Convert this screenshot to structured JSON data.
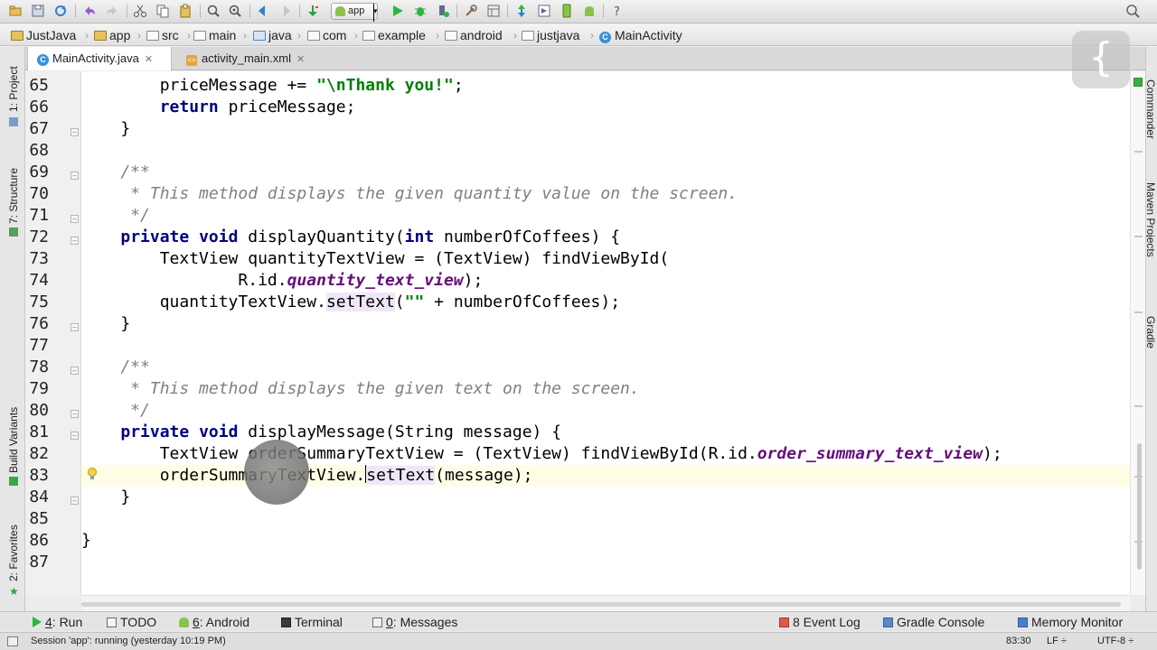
{
  "toolbar": {
    "run_config": "app",
    "icons": [
      "open-icon",
      "save-icon",
      "sync-icon",
      "undo-icon",
      "redo-icon",
      "cut-icon",
      "copy-icon",
      "paste-icon",
      "find-icon",
      "replace-icon",
      "back-icon",
      "forward-icon",
      "make-icon",
      "run-icon",
      "debug-icon",
      "attach-debugger-icon",
      "settings-icon",
      "project-structure-icon",
      "sdk-manager-icon",
      "avd-manager-icon",
      "android-device-monitor-icon",
      "gradle-sync-icon",
      "help-icon",
      "search-everywhere-icon"
    ]
  },
  "breadcrumb": [
    "JustJava",
    "app",
    "src",
    "main",
    "java",
    "com",
    "example",
    "android",
    "justjava",
    "MainActivity"
  ],
  "tabs": [
    {
      "label": "MainActivity.java",
      "active": true
    },
    {
      "label": "activity_main.xml",
      "active": false
    }
  ],
  "left_tools": {
    "project": "1: Project",
    "structure": "7: Structure",
    "build_variants": "Build Variants",
    "favorites": "2: Favorites"
  },
  "right_tools": {
    "commander": "Commander",
    "maven": "Maven Projects",
    "gradle": "Gradle"
  },
  "editor": {
    "line_numbers": [
      "65",
      "66",
      "67",
      "68",
      "69",
      "70",
      "71",
      "72",
      "73",
      "74",
      "75",
      "76",
      "77",
      "78",
      "79",
      "80",
      "81",
      "82",
      "83",
      "84",
      "85",
      "86",
      "87"
    ],
    "current_line": "83"
  },
  "code": {
    "l65": {
      "indent": "        ",
      "pre": "priceMessage += ",
      "str": "\"\\nThank you!\"",
      "post": ";"
    },
    "l66": {
      "indent": "        ",
      "kw": "return",
      "rest": " priceMessage;"
    },
    "l67": {
      "text": "    }"
    },
    "l69": {
      "text": "    /**"
    },
    "l70": {
      "text": "     * This method displays the given quantity value on the screen."
    },
    "l71": {
      "text": "     */"
    },
    "l72": {
      "indent": "    ",
      "kw1": "private",
      "kw2": "void",
      "name": " displayQuantity(",
      "kw3": "int",
      "rest": " numberOfCoffees) {"
    },
    "l73": {
      "text": "        TextView quantityTextView = (TextView) findViewById("
    },
    "l74": {
      "pre": "                R.id.",
      "field": "quantity_text_view",
      "post": ");"
    },
    "l75": {
      "pre": "        quantityTextView.",
      "method": "setText",
      "mid": "(",
      "str": "\"\"",
      "post": " + numberOfCoffees);"
    },
    "l76": {
      "text": "    }"
    },
    "l78": {
      "text": "    /**"
    },
    "l79": {
      "text": "     * This method displays the given text on the screen."
    },
    "l80": {
      "text": "     */"
    },
    "l81": {
      "indent": "    ",
      "kw1": "private",
      "kw2": "void",
      "rest": " displayMessage(String message) {"
    },
    "l82": {
      "pre": "        TextView orderSummaryTextView = (TextView) findViewById(R.id.",
      "field": "order_summary_text_view",
      "post": ");"
    },
    "l83": {
      "pre": "        orderSummaryTextView.",
      "method": "setText",
      "post": "(message);"
    },
    "l84": {
      "text": "    }"
    },
    "l86": {
      "text": "}"
    }
  },
  "tool_windows": {
    "run": {
      "key": "4",
      "label": ": Run"
    },
    "todo": "TODO",
    "android": {
      "key": "6",
      "label": ": Android"
    },
    "terminal": "Terminal",
    "messages": {
      "key": "0",
      "label": ": Messages"
    },
    "event_log": {
      "key": "8",
      "label": " Event Log"
    },
    "gradle_console": "Gradle Console",
    "memory_monitor": "Memory Monitor"
  },
  "status": {
    "message": "Session 'app': running (yesterday 10:19 PM)",
    "position": "83:30",
    "line_sep": "LF ÷",
    "encoding": "UTF-8 ÷"
  },
  "colors": {
    "keyword": "#000080",
    "string": "#008000",
    "doc_comment": "#808080",
    "field": "#660e7a",
    "current_line": "#fffde5",
    "accent_green": "#36b045"
  }
}
